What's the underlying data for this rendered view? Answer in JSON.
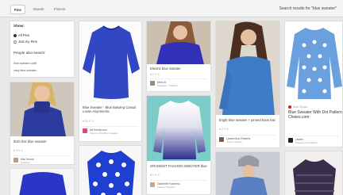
{
  "tabs": [
    "Pins",
    "Boards",
    "Pinners"
  ],
  "search_label": "Search results for \"blue sweater\"",
  "sidebar": {
    "show_label": "Show:",
    "options": [
      "All Pins",
      "Just my Pins"
    ],
    "also_label": "People also search:",
    "suggestions": [
      "blue sweater outfit",
      "navy blue sweater"
    ]
  },
  "pins": {
    "p1": {
      "caption": "Blue Sweater - Blue Batwing Casual Loose Asymmetric",
      "stats": "♥ 15   ✎ 3",
      "source": "bizTrendy.com",
      "source_sub": "Summer 2014 Blue Sweater"
    },
    "p2": {
      "caption": "Ibizh this blue sweater",
      "stats": "♥ 4   ✎ 1",
      "name": "Mia Tunnia",
      "sub": "Sweaters"
    },
    "p3": {
      "caption": "Electric blue sweater",
      "stats": "♥ 2   ✎ 5",
      "name": "Meru B.",
      "sub": "Sweaters + Knitwear"
    },
    "p4": {
      "caption": "GRADIENT FASHION SWEATER blue",
      "stats": "♥ 4   ✎ 3",
      "name": "Gabrielle Fosnerus",
      "sub": "Fashion Sweaters"
    },
    "p5": {
      "caption": "bright blue sweater + pinned back hair",
      "stats": "♥ 2   ✎ 5",
      "name": "Lauren Ann Roberts",
      "sub": "unicorn sweater"
    },
    "p6": {
      "title": "Blue Sweater With Dot Pattern Choies.com",
      "from": "from Choies",
      "source": "choies",
      "source_sub": "Sweaters & Cardigans"
    }
  },
  "colors": {
    "accent": "#cc2127",
    "sweater_blue": "#2b3fb8",
    "bg": "#e9e9e9"
  }
}
